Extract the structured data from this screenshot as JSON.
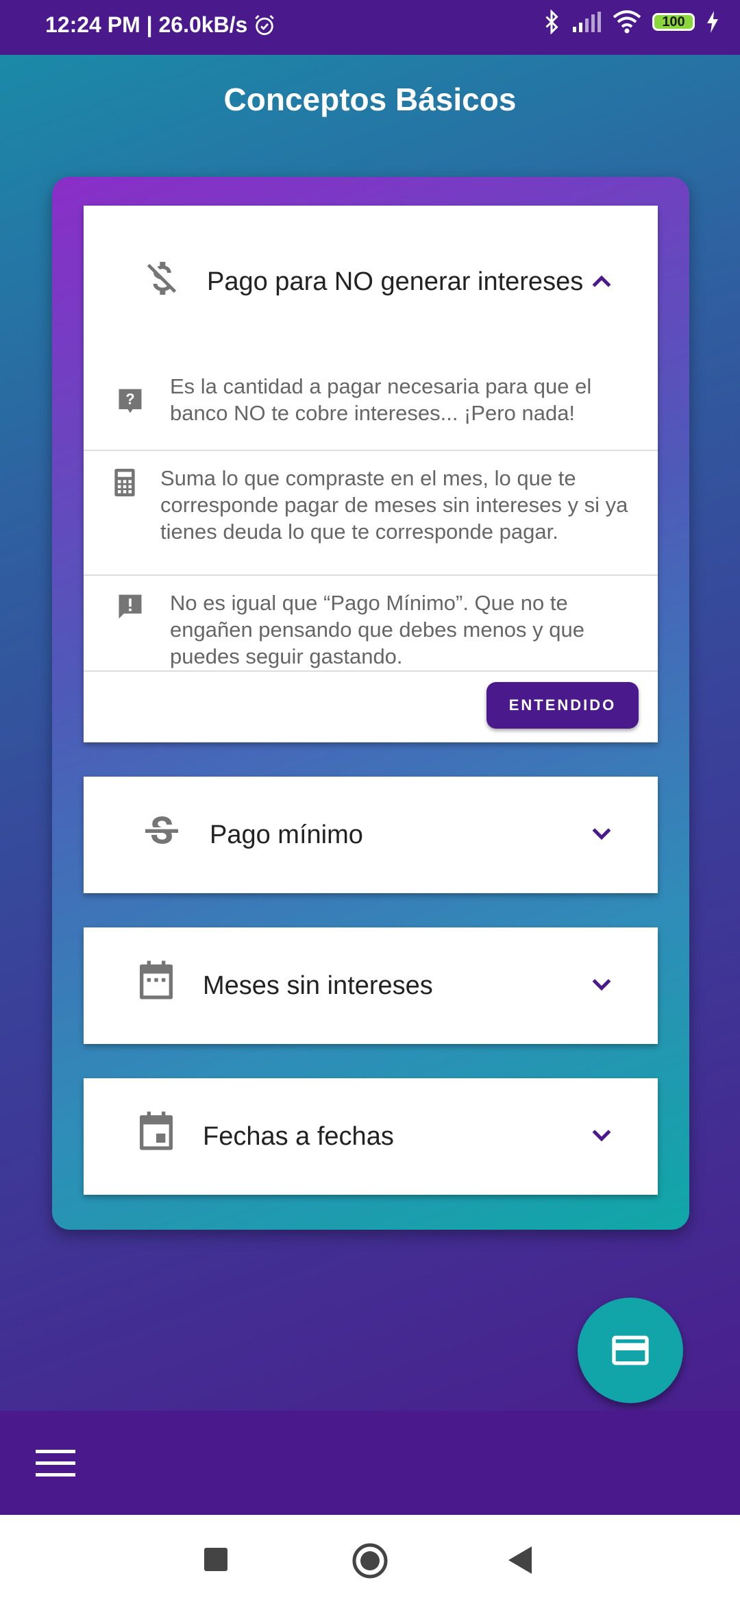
{
  "status_bar": {
    "time_speed": "12:24 PM | 26.0kB/s",
    "battery_level": "100"
  },
  "page": {
    "title": "Conceptos Básicos"
  },
  "cards": {
    "pago_no_intereses": {
      "title": "Pago para NO generar intereses",
      "icon": "no-money-icon",
      "expanded": true,
      "rows": [
        "Es la cantidad a pagar necesaria para que el banco NO te cobre intereses... ¡Pero nada!",
        "Suma lo que compraste en el mes, lo que te corresponde pagar de meses sin intereses y si ya tienes deuda lo que te corresponde pagar.",
        "No es igual que “Pago Mínimo”. Que no te engañen pensando que debes menos y que puedes seguir gastando."
      ],
      "button_label": "ENTENDIDO"
    },
    "pago_minimo": {
      "title": "Pago mínimo",
      "icon": "strikethrough-s-icon"
    },
    "meses_sin_intereses": {
      "title": "Meses sin intereses",
      "icon": "calendar-icon"
    },
    "fechas": {
      "title": "Fechas a fechas",
      "icon": "calendar-event-icon"
    }
  },
  "colors": {
    "primary": "#4a1a8c",
    "accent": "#11a4a9",
    "icon_grey": "#757575"
  }
}
